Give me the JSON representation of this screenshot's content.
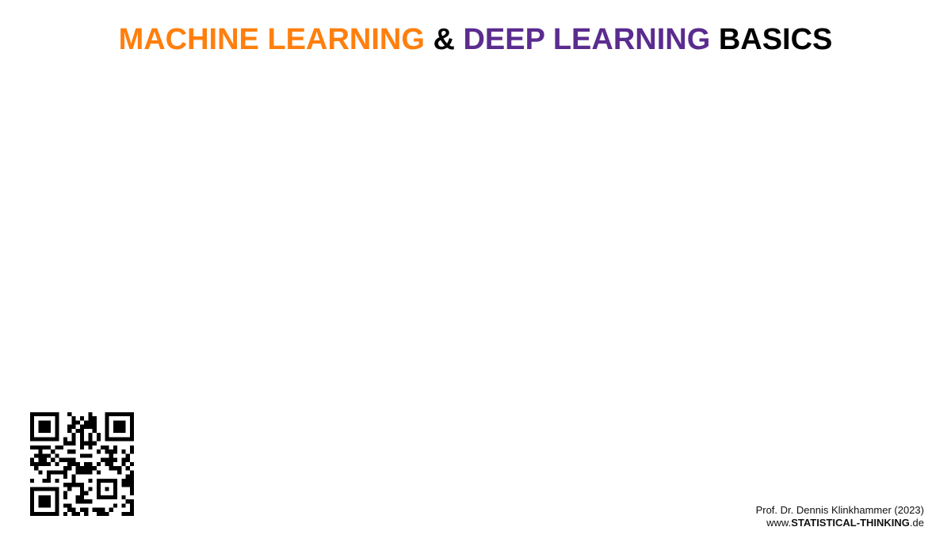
{
  "title": {
    "part1": "MACHINE LEARNING",
    "amp": " & ",
    "part2": "DEEP LEARNING",
    "part3": " BASICS",
    "colors": {
      "part1": "#FF7F0E",
      "amp": "#000000",
      "part2": "#5B2C8F",
      "part3": "#000000"
    }
  },
  "qr_code": {
    "icon": "qr-code-icon"
  },
  "footer": {
    "author": "Prof. Dr. Dennis Klinkhammer (2023)",
    "url_prefix": "www.",
    "url_bold": "STATISTICAL-THINKING",
    "url_suffix": ".de"
  }
}
